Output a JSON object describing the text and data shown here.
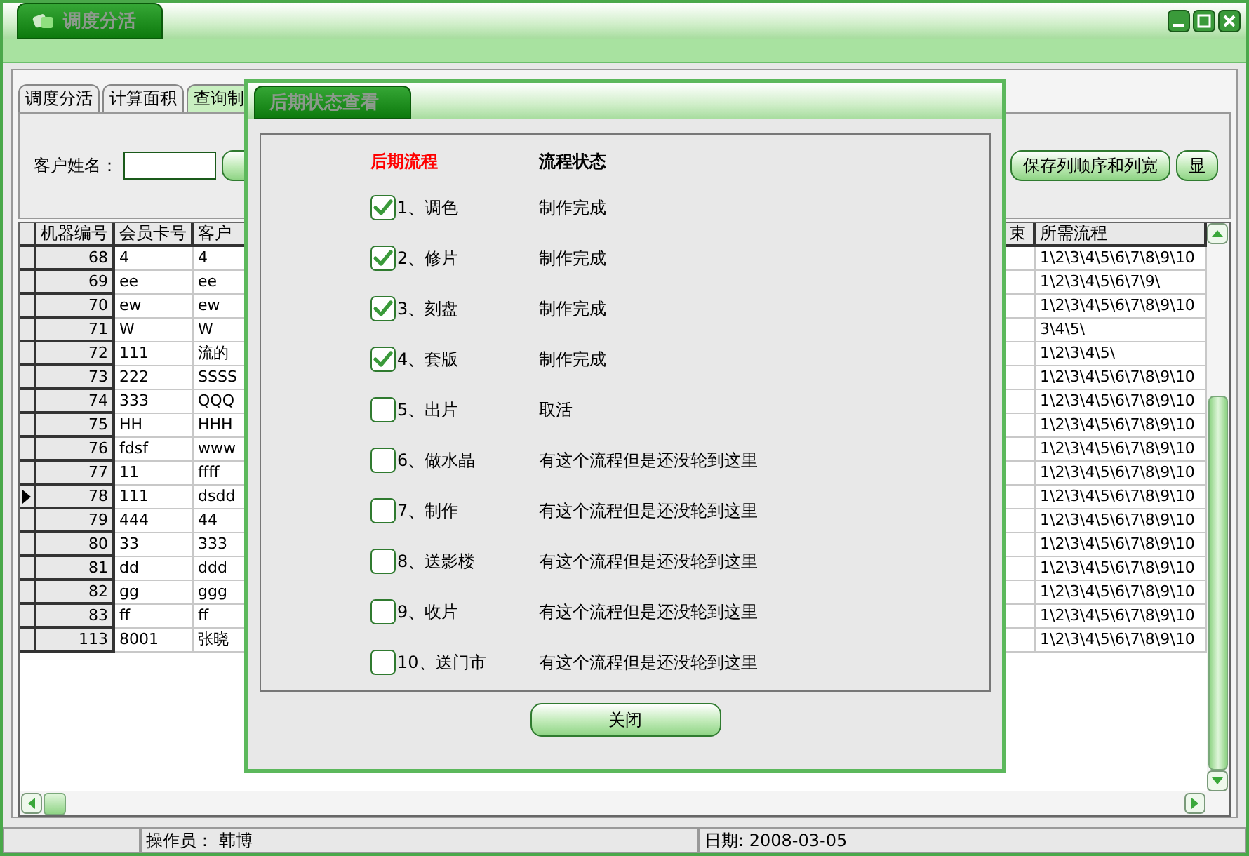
{
  "window": {
    "title": "调度分活"
  },
  "tabs": [
    {
      "label": "调度分活",
      "selected": false
    },
    {
      "label": "计算面积",
      "selected": false
    },
    {
      "label": "查询制",
      "selected": true
    }
  ],
  "search": {
    "label": "客户姓名："
  },
  "buttons": [
    "保存列顺序和列宽",
    "显"
  ],
  "table": {
    "columns": [
      "机器编号",
      "会员卡号",
      "客户",
      "束",
      "所需流程"
    ],
    "rows": [
      {
        "cells": [
          "68",
          "4",
          "4",
          "",
          "1\\2\\3\\4\\5\\6\\7\\8\\9\\10"
        ],
        "selected": false
      },
      {
        "cells": [
          "69",
          "ee",
          "ee",
          "",
          "1\\2\\3\\4\\5\\6\\7\\9\\"
        ],
        "selected": false
      },
      {
        "cells": [
          "70",
          "ew",
          "ew",
          "",
          "1\\2\\3\\4\\5\\6\\7\\8\\9\\10"
        ],
        "selected": false
      },
      {
        "cells": [
          "71",
          "W",
          "W",
          "",
          "3\\4\\5\\"
        ],
        "selected": false
      },
      {
        "cells": [
          "72",
          "111",
          "流的",
          "",
          "1\\2\\3\\4\\5\\"
        ],
        "selected": false
      },
      {
        "cells": [
          "73",
          "222",
          "SSSS",
          "",
          "1\\2\\3\\4\\5\\6\\7\\8\\9\\10"
        ],
        "selected": false
      },
      {
        "cells": [
          "74",
          "333",
          "QQQ",
          "",
          "1\\2\\3\\4\\5\\6\\7\\8\\9\\10"
        ],
        "selected": false
      },
      {
        "cells": [
          "75",
          "HH",
          "HHH",
          "",
          "1\\2\\3\\4\\5\\6\\7\\8\\9\\10"
        ],
        "selected": false
      },
      {
        "cells": [
          "76",
          "fdsf",
          "www",
          "",
          "1\\2\\3\\4\\5\\6\\7\\8\\9\\10"
        ],
        "selected": false
      },
      {
        "cells": [
          "77",
          "11",
          "ffff",
          "",
          "1\\2\\3\\4\\5\\6\\7\\8\\9\\10"
        ],
        "selected": false
      },
      {
        "cells": [
          "78",
          "111",
          "dsdd",
          "",
          "1\\2\\3\\4\\5\\6\\7\\8\\9\\10"
        ],
        "selected": true
      },
      {
        "cells": [
          "79",
          "444",
          "44",
          "",
          "1\\2\\3\\4\\5\\6\\7\\8\\9\\10"
        ],
        "selected": false
      },
      {
        "cells": [
          "80",
          "33",
          "333",
          "",
          "1\\2\\3\\4\\5\\6\\7\\8\\9\\10"
        ],
        "selected": false
      },
      {
        "cells": [
          "81",
          "dd",
          "ddd",
          "",
          "1\\2\\3\\4\\5\\6\\7\\8\\9\\10"
        ],
        "selected": false
      },
      {
        "cells": [
          "82",
          "gg",
          "ggg",
          "",
          "1\\2\\3\\4\\5\\6\\7\\8\\9\\10"
        ],
        "selected": false
      },
      {
        "cells": [
          "83",
          "ff",
          "ff",
          "",
          "1\\2\\3\\4\\5\\6\\7\\8\\9\\10"
        ],
        "selected": false
      },
      {
        "cells": [
          "113",
          "8001",
          "张晓",
          "",
          "1\\2\\3\\4\\5\\6\\7\\8\\9\\10"
        ],
        "selected": false
      }
    ]
  },
  "dialog": {
    "title": "后期状态查看",
    "headers": [
      "后期流程",
      "流程状态"
    ],
    "items": [
      {
        "label": "1、调色",
        "status": "制作完成",
        "checked": true
      },
      {
        "label": "2、修片",
        "status": "制作完成",
        "checked": true
      },
      {
        "label": "3、刻盘",
        "status": "制作完成",
        "checked": true
      },
      {
        "label": "4、套版",
        "status": "制作完成",
        "checked": true
      },
      {
        "label": "5、出片",
        "status": "取活",
        "checked": false
      },
      {
        "label": "6、做水晶",
        "status": "有这个流程但是还没轮到这里",
        "checked": false
      },
      {
        "label": "7、制作",
        "status": "有这个流程但是还没轮到这里",
        "checked": false
      },
      {
        "label": "8、送影楼",
        "status": "有这个流程但是还没轮到这里",
        "checked": false
      },
      {
        "label": "9、收片",
        "status": "有这个流程但是还没轮到这里",
        "checked": false
      },
      {
        "label": "10、送门市",
        "status": "有这个流程但是还没轮到这里",
        "checked": false
      }
    ],
    "button": "关闭"
  },
  "status_bar": {
    "operator": "操作员： 韩博",
    "date": "日期: 2008-03-05"
  }
}
